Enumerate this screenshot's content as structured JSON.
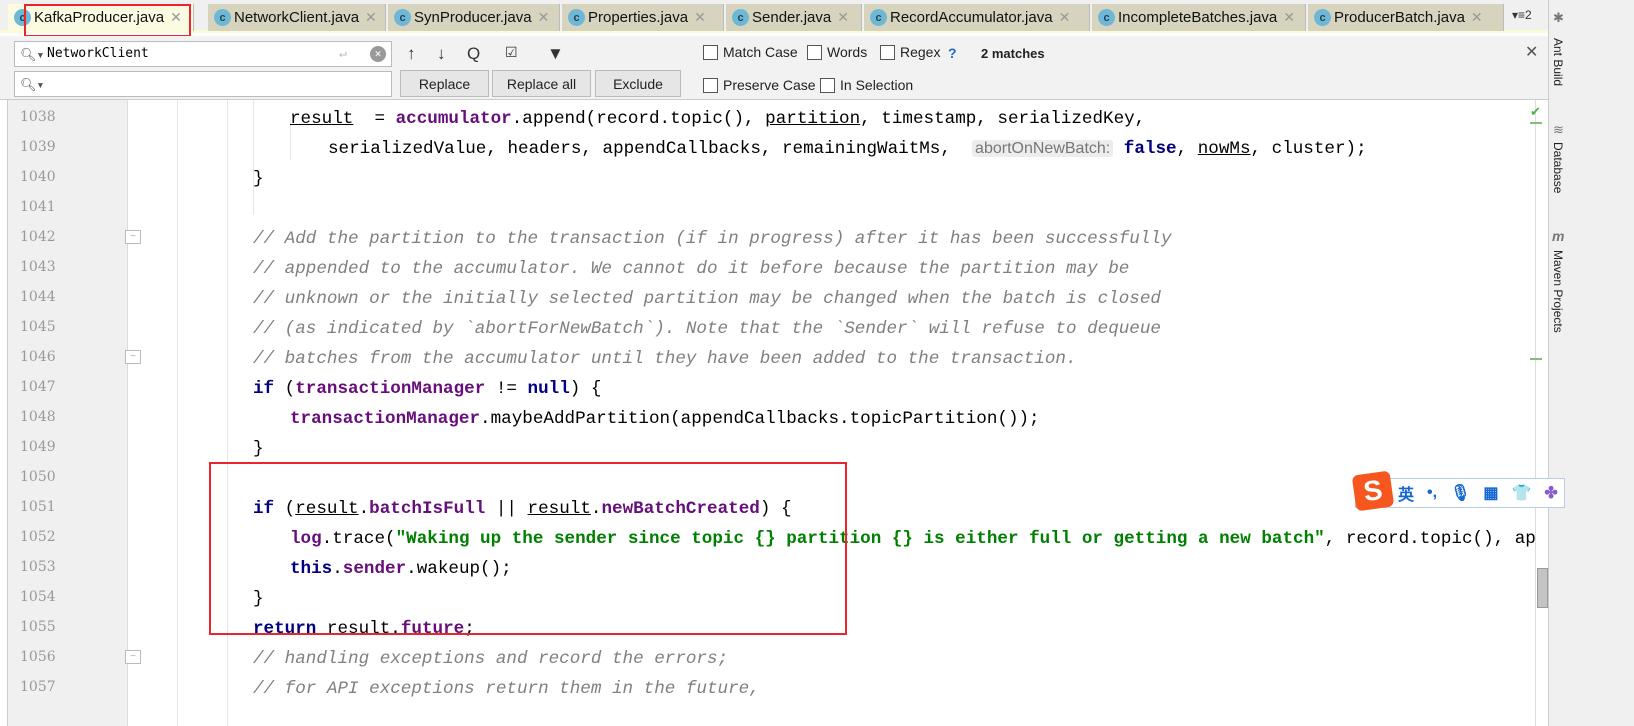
{
  "tabs": [
    {
      "label": "KafkaProducer.java",
      "active": true
    },
    {
      "label": "NetworkClient.java"
    },
    {
      "label": "SynProducer.java"
    },
    {
      "label": "Properties.java"
    },
    {
      "label": "Sender.java"
    },
    {
      "label": "RecordAccumulator.java"
    },
    {
      "label": "IncompleteBatches.java"
    },
    {
      "label": "ProducerBatch.java"
    }
  ],
  "tab_overflow": "▾≡2",
  "find": {
    "search_value": "NetworkClient",
    "replace_value": "",
    "replace_label": "Replace",
    "replace_all_label": "Replace all",
    "exclude_label": "Exclude",
    "match_case": "Match Case",
    "words": "Words",
    "regex": "Regex",
    "help": "?",
    "matches": "2 matches",
    "preserve_case": "Preserve Case",
    "in_selection": "In Selection",
    "close": "✕"
  },
  "sidebar": {
    "ant": "Ant Build",
    "database": "Database",
    "maven": "Maven Projects"
  },
  "ime": {
    "lang": "英",
    "punct": "•,",
    "mic": "🎙",
    "kbd": "▦",
    "skin": "👕",
    "more": "✤",
    "logo": "S"
  },
  "accent": "#e8262c",
  "lines": [
    {
      "n": "1038",
      "indent": 3,
      "t": [
        [
          "ul",
          "result"
        ],
        [
          "",
          "  = "
        ],
        [
          "fld",
          "accumulator"
        ],
        [
          "",
          ".append(record.topic(), "
        ],
        [
          "ul",
          "partition"
        ],
        [
          "",
          ", timestamp, serializedKey,"
        ]
      ]
    },
    {
      "n": "1039",
      "indent": 4,
      "t": [
        [
          "",
          "serializedValue, headers, appendCallbacks, remainingWaitMs,  "
        ],
        [
          "hint",
          "abortOnNewBatch:"
        ],
        [
          "kw",
          " false"
        ],
        [
          "",
          ", "
        ],
        [
          "ul",
          "nowMs"
        ],
        [
          "",
          ", cluster);"
        ]
      ]
    },
    {
      "n": "1040",
      "indent": 2,
      "t": [
        [
          "",
          "}"
        ]
      ]
    },
    {
      "n": "1041",
      "indent": 2,
      "t": []
    },
    {
      "n": "1042",
      "indent": 2,
      "fold": true,
      "t": [
        [
          "cm",
          "// Add the partition to the transaction (if in progress) after it has been successfully"
        ]
      ]
    },
    {
      "n": "1043",
      "indent": 2,
      "t": [
        [
          "cm",
          "// appended to the accumulator. We cannot do it before because the partition may be"
        ]
      ]
    },
    {
      "n": "1044",
      "indent": 2,
      "t": [
        [
          "cm",
          "// unknown or the initially selected partition may be changed when the batch is closed"
        ]
      ]
    },
    {
      "n": "1045",
      "indent": 2,
      "t": [
        [
          "cm",
          "// (as indicated by `abortForNewBatch`). Note that the `Sender` will refuse to dequeue"
        ]
      ]
    },
    {
      "n": "1046",
      "indent": 2,
      "fold": true,
      "t": [
        [
          "cm",
          "// batches from the accumulator until they have been added to the transaction."
        ]
      ]
    },
    {
      "n": "1047",
      "indent": 2,
      "t": [
        [
          "kw",
          "if"
        ],
        [
          "",
          " ("
        ],
        [
          "fld",
          "transactionManager"
        ],
        [
          "",
          " != "
        ],
        [
          "kw",
          "null"
        ],
        [
          "",
          ") {"
        ]
      ]
    },
    {
      "n": "1048",
      "indent": 3,
      "t": [
        [
          "fld",
          "transactionManager"
        ],
        [
          "",
          ".maybeAddPartition(appendCallbacks.topicPartition());"
        ]
      ]
    },
    {
      "n": "1049",
      "indent": 2,
      "t": [
        [
          "",
          "}"
        ]
      ]
    },
    {
      "n": "1050",
      "indent": 2,
      "t": []
    },
    {
      "n": "1051",
      "indent": 2,
      "t": [
        [
          "kw",
          "if"
        ],
        [
          "",
          " ("
        ],
        [
          "ul",
          "result"
        ],
        [
          "",
          "."
        ],
        [
          "fld",
          "batchIsFull"
        ],
        [
          "",
          " || "
        ],
        [
          "ul",
          "result"
        ],
        [
          "",
          "."
        ],
        [
          "fld",
          "newBatchCreated"
        ],
        [
          "",
          ") {"
        ]
      ]
    },
    {
      "n": "1052",
      "indent": 3,
      "t": [
        [
          "fld",
          "log"
        ],
        [
          "",
          ".trace("
        ],
        [
          "str",
          "\"Waking up the sender since topic {} partition {} is either full or getting a new batch\""
        ],
        [
          "",
          ", record.topic(), appendCallbacks.topicPartition());"
        ]
      ]
    },
    {
      "n": "1053",
      "indent": 3,
      "t": [
        [
          "kw",
          "this"
        ],
        [
          "",
          "."
        ],
        [
          "fld",
          "sender"
        ],
        [
          "",
          ".wakeup();"
        ]
      ]
    },
    {
      "n": "1054",
      "indent": 2,
      "t": [
        [
          "",
          "}"
        ]
      ]
    },
    {
      "n": "1055",
      "indent": 2,
      "t": [
        [
          "kw",
          "return"
        ],
        [
          "",
          " "
        ],
        [
          "ul",
          "result"
        ],
        [
          "",
          "."
        ],
        [
          "fld",
          "future"
        ],
        [
          "",
          ";"
        ]
      ]
    },
    {
      "n": "1056",
      "indent": 2,
      "fold": true,
      "t": [
        [
          "cm",
          "// handling exceptions and record the errors;"
        ]
      ]
    },
    {
      "n": "1057",
      "indent": 2,
      "t": [
        [
          "cm",
          "// for API exceptions return them in the future,"
        ]
      ]
    }
  ]
}
